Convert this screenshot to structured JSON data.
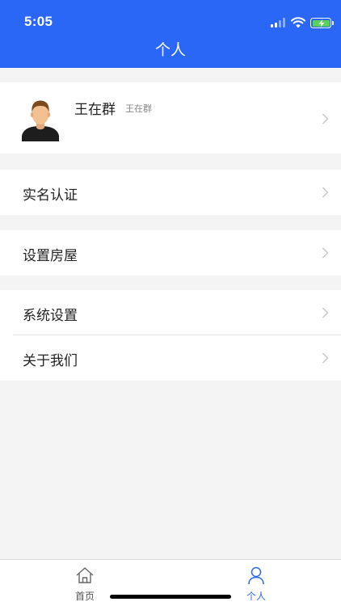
{
  "status_bar": {
    "time": "5:05"
  },
  "nav": {
    "title": "个人"
  },
  "profile": {
    "name": "王在群",
    "username": "王在群"
  },
  "menu": {
    "realname": "实名认证",
    "house": "设置房屋",
    "system": "系统设置",
    "about": "关于我们"
  },
  "tabbar": {
    "home": "首页",
    "personal": "个人"
  },
  "colors": {
    "brand_blue": "#2b67f7",
    "background": "#f4f4f4",
    "battery_green": "#58d25a"
  },
  "icons": {
    "status": [
      "signal-icon",
      "wifi-icon",
      "battery-charging-icon"
    ],
    "rows": "chevron-right-icon",
    "tabs": [
      "home-icon",
      "person-icon"
    ]
  }
}
